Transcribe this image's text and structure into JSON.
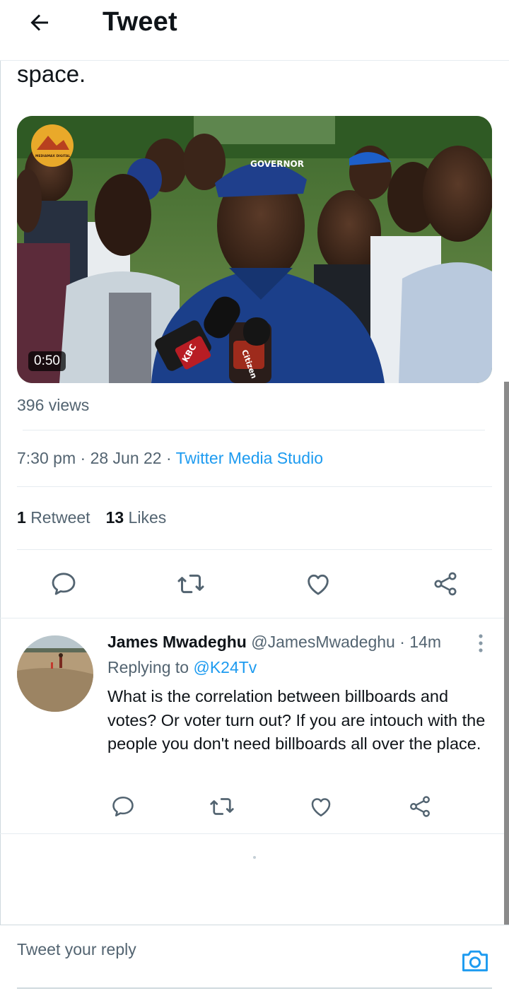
{
  "header": {
    "title": "Tweet",
    "back_icon": "arrow-left-icon"
  },
  "tweet": {
    "text_tail": "space.",
    "media": {
      "duration": "0:50",
      "logo_text": "MEDIAMAX DIGITAL",
      "cap_text": "GOVERNOR",
      "mic_labels": [
        "KBC",
        "Citizen"
      ]
    },
    "views": "396 views",
    "time": "7:30 pm",
    "date": "28 Jun 22",
    "source": "Twitter Media Studio",
    "separator": " · ",
    "retweet_count": "1",
    "retweet_label": "Retweet",
    "likes_count": "13",
    "likes_label": "Likes",
    "actions": [
      "reply-icon",
      "retweet-icon",
      "like-icon",
      "share-icon"
    ]
  },
  "reply": {
    "name": "James Mwadeghu",
    "handle": "@JamesMwadeghu",
    "time": "14m",
    "replying_prefix": "Replying to",
    "replying_to": "@K24Tv",
    "text": "What is the correlation between billboards and votes? Or voter turn out? If you are intouch with the people you don't need billboards all over the place."
  },
  "composer": {
    "placeholder": "Tweet your reply"
  },
  "colors": {
    "accent": "#1d9bf0",
    "secondary_text": "#536471",
    "primary_text": "#0f1419",
    "border": "#e6ecf0"
  }
}
